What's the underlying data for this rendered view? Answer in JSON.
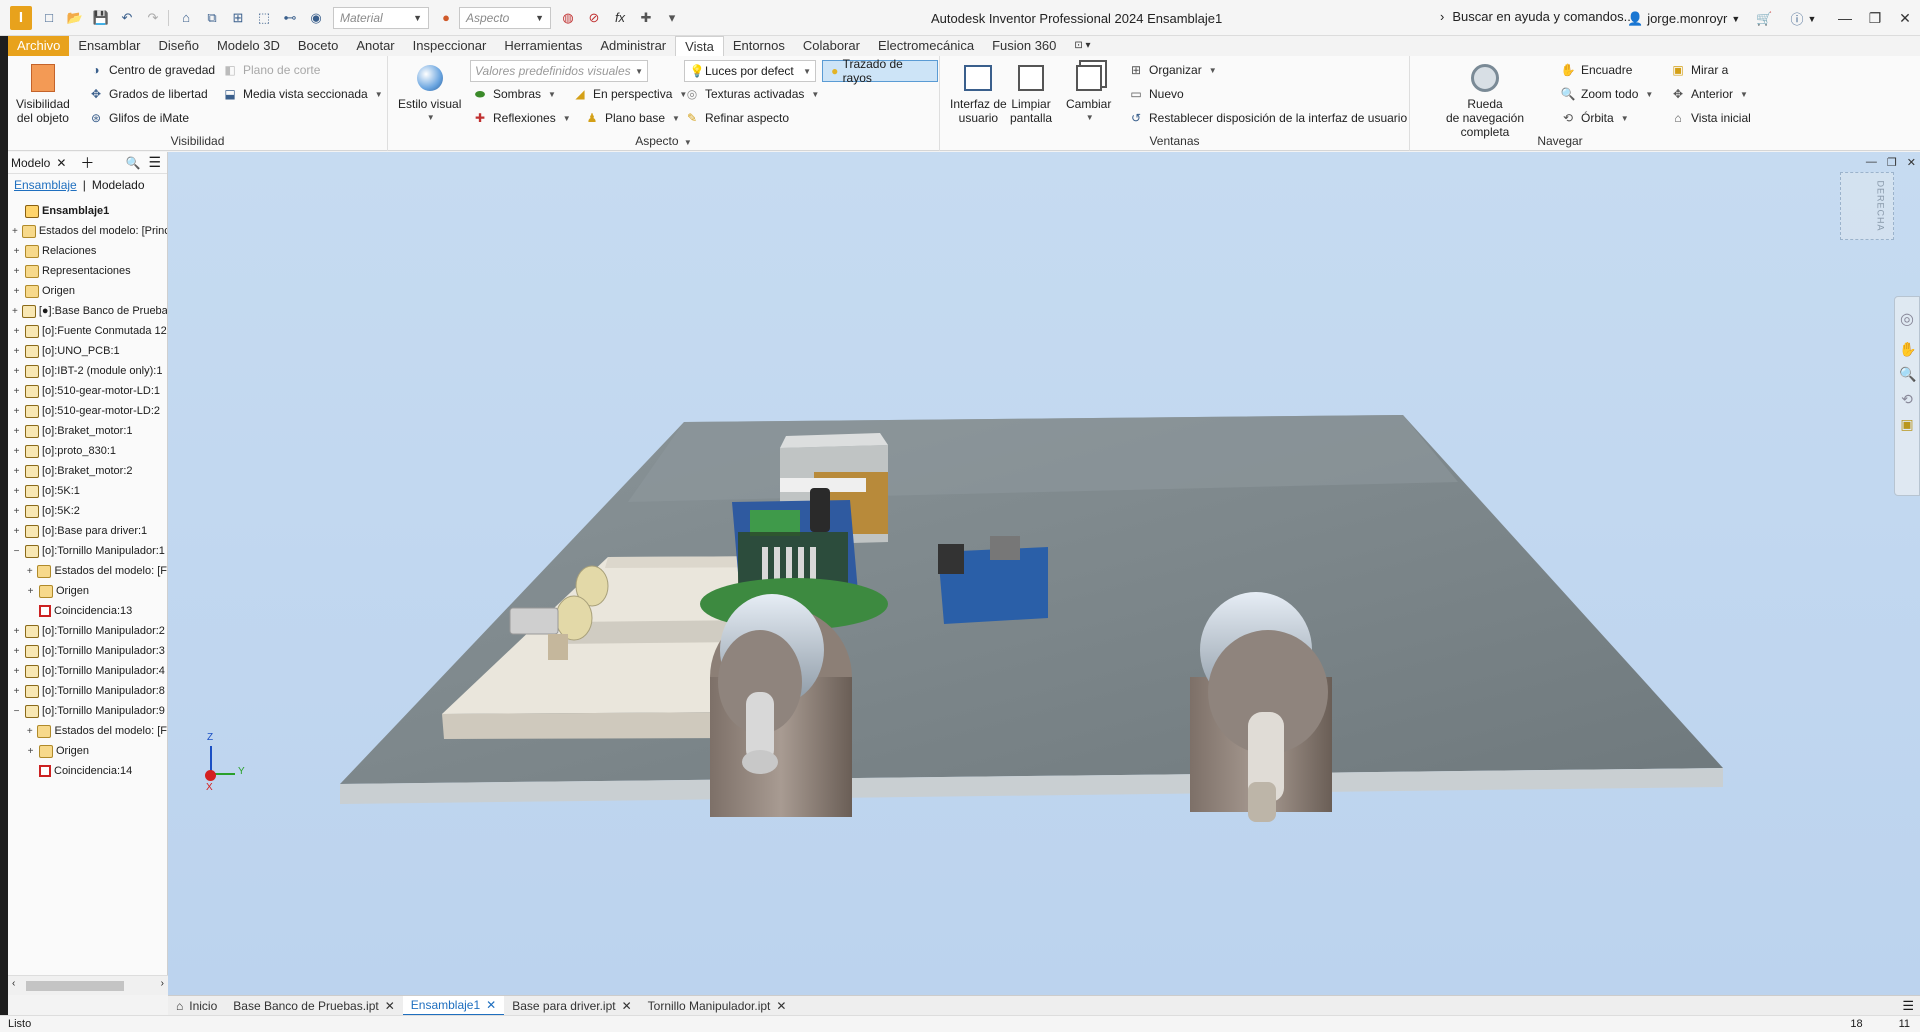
{
  "app": {
    "window_title": "Autodesk Inventor Professional 2024   Ensamblaje1",
    "logo_letter": "I",
    "material_placeholder": "Material",
    "appearance_placeholder": "Aspecto",
    "search_placeholder": "Buscar en ayuda y comandos...",
    "user": "jorge.monroyr"
  },
  "menu": [
    "Archivo",
    "Ensamblar",
    "Diseño",
    "Modelo 3D",
    "Boceto",
    "Anotar",
    "Inspeccionar",
    "Herramientas",
    "Administrar",
    "Vista",
    "Entornos",
    "Colaborar",
    "Electromecánica",
    "Fusion 360"
  ],
  "menu_active": "Vista",
  "ribbon": {
    "visibilidad": {
      "title": "Visibilidad",
      "big": "Visibilidad\ndel objeto",
      "items": [
        "Centro de gravedad",
        "Grados de libertad",
        "Glifos de iMate",
        "Plano de corte",
        "Media vista seccionada"
      ]
    },
    "aspecto": {
      "title": "Aspecto",
      "big": "Estilo visual",
      "preset_placeholder": "Valores predefinidos visuales",
      "lights": "Luces por defect",
      "raytrace": "Trazado de rayos",
      "items": [
        "Sombras",
        "En perspectiva",
        "Texturas activadas",
        "Reflexiones",
        "Plano base",
        "Refinar aspecto"
      ]
    },
    "ventanas": {
      "title": "Ventanas",
      "big1": "Interfaz de\nusuario",
      "big2": "Limpiar\npantalla",
      "big3": "Cambiar",
      "items": [
        "Organizar",
        "Nuevo",
        "Restablecer disposición de la interfaz de usuario"
      ]
    },
    "navegar": {
      "title": "Navegar",
      "big": "Rueda\nde navegación completa",
      "items": [
        "Encuadre",
        "Zoom todo",
        "Órbita",
        "Mirar a",
        "Anterior",
        "Vista inicial"
      ]
    }
  },
  "browser": {
    "title": "Modelo",
    "tab1": "Ensamblaje",
    "tab2": "Modelado",
    "tree": [
      {
        "label": "Ensamblaje1",
        "level": 0,
        "exp": "",
        "icon": "asm",
        "bold": true
      },
      {
        "label": "Estados del modelo: [Princ",
        "level": 0,
        "exp": "+",
        "icon": "folder"
      },
      {
        "label": "Relaciones",
        "level": 0,
        "exp": "+",
        "icon": "folder"
      },
      {
        "label": "Representaciones",
        "level": 0,
        "exp": "+",
        "icon": "folder"
      },
      {
        "label": "Origen",
        "level": 0,
        "exp": "+",
        "icon": "folder"
      },
      {
        "label": "[●]:Base Banco de Prueba",
        "level": 0,
        "exp": "+",
        "icon": "part"
      },
      {
        "label": "[o]:Fuente Conmutada 12",
        "level": 0,
        "exp": "+",
        "icon": "part"
      },
      {
        "label": "[o]:UNO_PCB:1",
        "level": 0,
        "exp": "+",
        "icon": "part"
      },
      {
        "label": "[o]:IBT-2 (module only):1",
        "level": 0,
        "exp": "+",
        "icon": "part"
      },
      {
        "label": "[o]:510-gear-motor-LD:1",
        "level": 0,
        "exp": "+",
        "icon": "part"
      },
      {
        "label": "[o]:510-gear-motor-LD:2",
        "level": 0,
        "exp": "+",
        "icon": "part"
      },
      {
        "label": "[o]:Braket_motor:1",
        "level": 0,
        "exp": "+",
        "icon": "part"
      },
      {
        "label": "[o]:proto_830:1",
        "level": 0,
        "exp": "+",
        "icon": "part"
      },
      {
        "label": "[o]:Braket_motor:2",
        "level": 0,
        "exp": "+",
        "icon": "part"
      },
      {
        "label": "[o]:5K:1",
        "level": 0,
        "exp": "+",
        "icon": "part"
      },
      {
        "label": "[o]:5K:2",
        "level": 0,
        "exp": "+",
        "icon": "part"
      },
      {
        "label": "[o]:Base para driver:1",
        "level": 0,
        "exp": "+",
        "icon": "part"
      },
      {
        "label": "[o]:Tornillo Manipulador:1",
        "level": 0,
        "exp": "−",
        "icon": "part"
      },
      {
        "label": "Estados del modelo: [F",
        "level": 1,
        "exp": "+",
        "icon": "folder"
      },
      {
        "label": "Origen",
        "level": 1,
        "exp": "+",
        "icon": "folder"
      },
      {
        "label": "Coincidencia:13",
        "level": 1,
        "exp": "",
        "icon": "constraint"
      },
      {
        "label": "[o]:Tornillo Manipulador:2",
        "level": 0,
        "exp": "+",
        "icon": "part"
      },
      {
        "label": "[o]:Tornillo Manipulador:3",
        "level": 0,
        "exp": "+",
        "icon": "part"
      },
      {
        "label": "[o]:Tornillo Manipulador:4",
        "level": 0,
        "exp": "+",
        "icon": "part"
      },
      {
        "label": "[o]:Tornillo Manipulador:8",
        "level": 0,
        "exp": "+",
        "icon": "part"
      },
      {
        "label": "[o]:Tornillo Manipulador:9",
        "level": 0,
        "exp": "−",
        "icon": "part"
      },
      {
        "label": "Estados del modelo: [F",
        "level": 1,
        "exp": "+",
        "icon": "folder"
      },
      {
        "label": "Origen",
        "level": 1,
        "exp": "+",
        "icon": "folder"
      },
      {
        "label": "Coincidencia:14",
        "level": 1,
        "exp": "",
        "icon": "constraint"
      }
    ]
  },
  "viewcube_label": "DERECHA",
  "axis": {
    "z": "Z",
    "y": "Y",
    "x": "X"
  },
  "doc_tabs": [
    "Inicio",
    "Base Banco de Pruebas.ipt",
    "Ensamblaje1",
    "Base para driver.ipt",
    "Tornillo Manipulador.ipt"
  ],
  "doc_tab_active": "Ensamblaje1",
  "status": {
    "text": "Listo",
    "num1": "18",
    "num2": "11"
  }
}
